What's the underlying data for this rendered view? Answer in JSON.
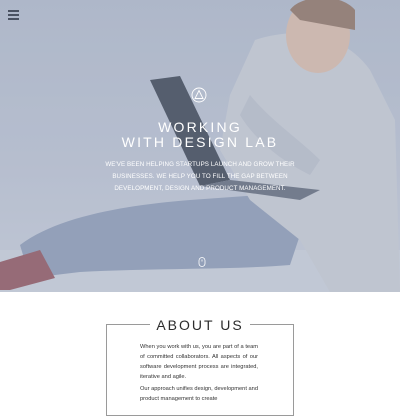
{
  "hero": {
    "title_line1": "WORKING",
    "title_line2": "WITH DESIGN LAB",
    "subtitle": "WE'VE BEEN HELPING STARTUPS LAUNCH AND GROW THEIR BUSINESSES. WE HELP YOU TO FILL THE GAP BETWEEN DEVELOPMENT, DESIGN AND PRODUCT MANAGEMENT."
  },
  "about": {
    "title": "ABOUT US",
    "paragraph1": "When you work with us, you are part of a team of committed collaborators. All aspects of our software development process are integrated, iterative and agile.",
    "paragraph2": "Our approach unifies design, development and product management to create"
  },
  "icons": {
    "menu": "hamburger-menu-icon",
    "logo": "triangle-logo-icon",
    "scroll": "scroll-down-icon"
  },
  "colors": {
    "hero_overlay": "#b0bace",
    "text_dark": "#2c2c2c",
    "frame": "#9a9a9a"
  }
}
